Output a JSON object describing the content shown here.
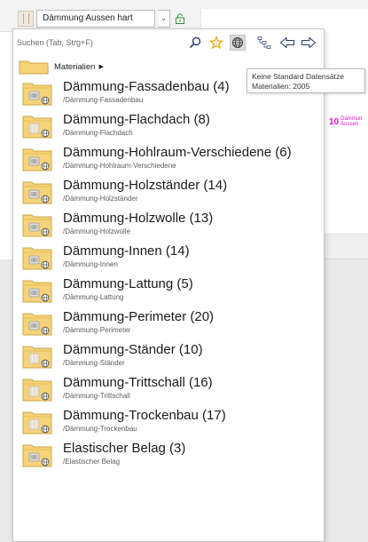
{
  "selector": {
    "current_material": "Dämmung Aussen hart"
  },
  "background": {
    "marker_number": "10",
    "marker_line1": "Dämmun",
    "marker_line2": "Aussen"
  },
  "search": {
    "placeholder": "Suchen (Tab, Strg+F)"
  },
  "toolbar": {
    "icons": [
      "search-icon",
      "favorite-star-icon",
      "global-catalog-icon",
      "tree-structure-icon",
      "back-arrow-icon",
      "forward-arrow-icon"
    ],
    "selected": "global-catalog-icon"
  },
  "breadcrumb": {
    "label": "Materialien"
  },
  "tooltip": {
    "line1": "Keine Standard Datensätze",
    "line2": "Materialien: 2005"
  },
  "colors": {
    "folder": "#f5d37a",
    "folder_edge": "#c9a84b",
    "marker": "#e012c8",
    "star": "#e6a817"
  },
  "items": [
    {
      "title": "Dämmung-Fassadenbau (4)",
      "path": "/Dämmung-Fassadenbau",
      "thumb": "brick"
    },
    {
      "title": "Dämmung-Flachdach (8)",
      "path": "/Dämmung-Flachdach",
      "thumb": "fill"
    },
    {
      "title": "Dämmung-Hohlraum-Verschiedene (6)",
      "path": "/Dämmung-Hohlraum-Verschiedene",
      "thumb": "brick"
    },
    {
      "title": "Dämmung-Holzständer (14)",
      "path": "/Dämmung-Holzständer",
      "thumb": "brick"
    },
    {
      "title": "Dämmung-Holzwolle (13)",
      "path": "/Dämmung-Holzwolle",
      "thumb": "brick"
    },
    {
      "title": "Dämmung-Innen (14)",
      "path": "/Dämmung-Innen",
      "thumb": "brick"
    },
    {
      "title": "Dämmung-Lattung (5)",
      "path": "/Dämmung-Lattung",
      "thumb": "brick"
    },
    {
      "title": "Dämmung-Perimeter (20)",
      "path": "/Dämmung-Perimeter",
      "thumb": "brick"
    },
    {
      "title": "Dämmung-Ständer (10)",
      "path": "/Dämmung-Ständer",
      "thumb": "fill"
    },
    {
      "title": "Dämmung-Trittschall (16)",
      "path": "/Dämmung-Trittschall",
      "thumb": "fill"
    },
    {
      "title": "Dämmung-Trockenbau (17)",
      "path": "/Dämmung-Trockenbau",
      "thumb": "fill"
    },
    {
      "title": "Elastischer Belag (3)",
      "path": "/Elastischer Belag",
      "thumb": "brick"
    }
  ]
}
